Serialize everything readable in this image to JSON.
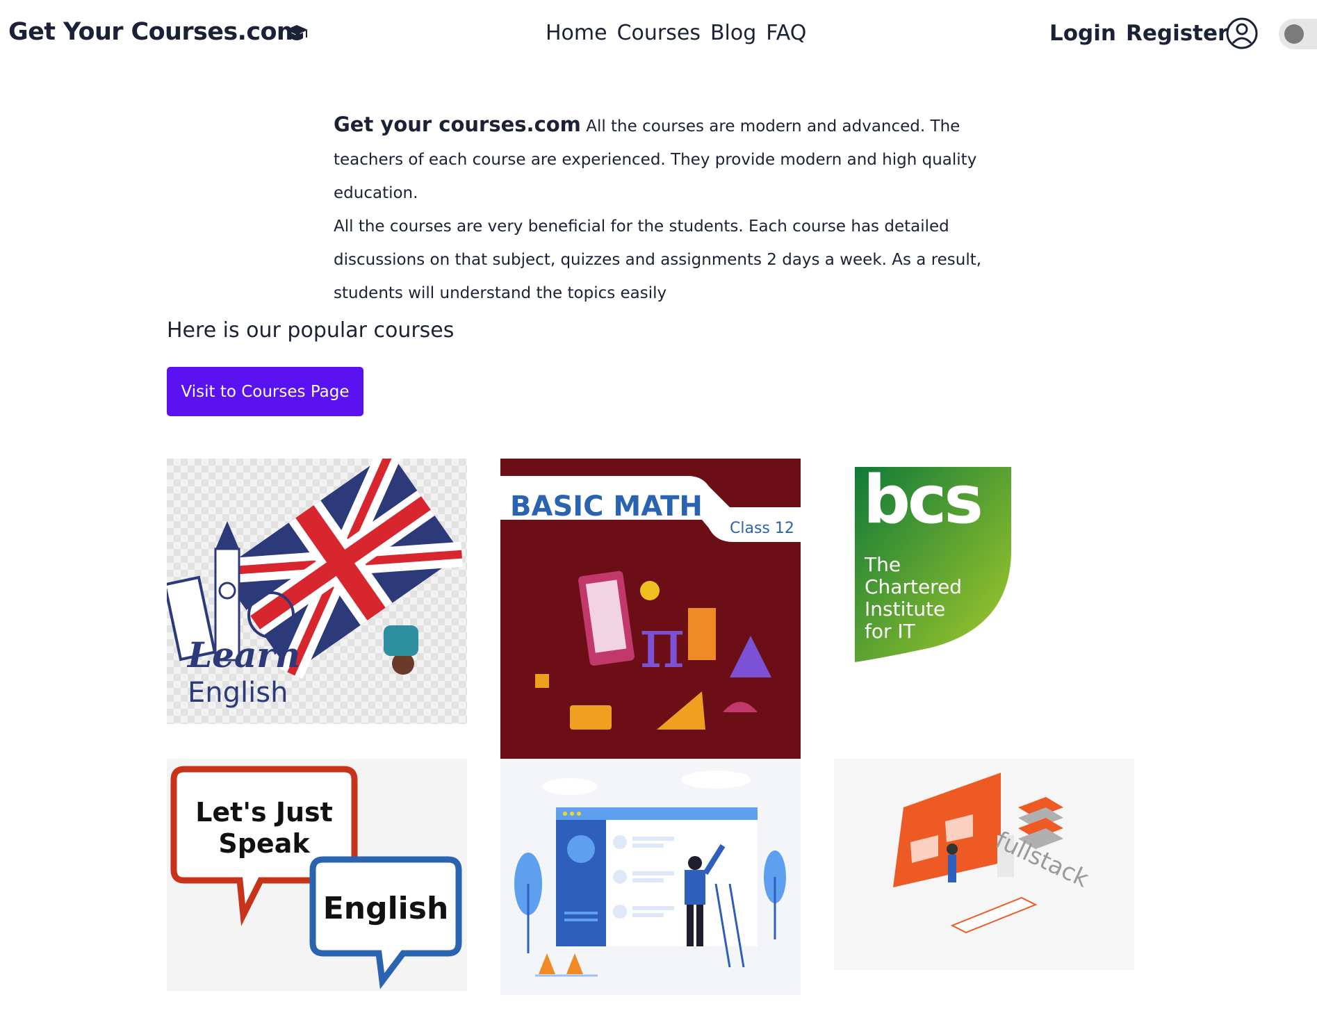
{
  "header": {
    "brand": "Get Your Courses.com",
    "brand_icon": "graduation-cap-icon",
    "nav": [
      "Home",
      "Courses",
      "Blog",
      "FAQ"
    ],
    "login": "Login",
    "register": "Register",
    "user_icon": "user-circle-icon",
    "theme_toggle": "dark-mode-toggle"
  },
  "intro": {
    "brand_strong": "Get your courses.com",
    "text_1": " All the courses are modern and advanced. The teachers of each course are experienced. They provide modern and high quality education.",
    "text_2": "All the courses are very beneficial for the students. Each course has detailed discussions on that subject, quizzes and assignments 2 days a week. As a result, students will understand the topics easily"
  },
  "popular": {
    "heading": "Here is our popular courses",
    "button": "Visit to Courses Page"
  },
  "courses": [
    {
      "image_label_1": "Learn",
      "image_label_2": "English"
    },
    {
      "image_title": "BASIC MATH",
      "image_sub": "Class 12",
      "symbol": "π"
    },
    {
      "logo": "bcs",
      "lines": [
        "The",
        "Chartered",
        "Institute",
        "for IT"
      ]
    },
    {
      "bubble_1": [
        "Let's Just",
        "Speak"
      ],
      "bubble_2": "English"
    },
    {
      "illustration": "web-design-illustration"
    },
    {
      "logo_text": "fullstack"
    }
  ],
  "colors": {
    "primary_button": "#5a12f0",
    "text": "#1b2236",
    "bcs_green": "#1f8f3a",
    "math_bg": "#6b0e16"
  }
}
